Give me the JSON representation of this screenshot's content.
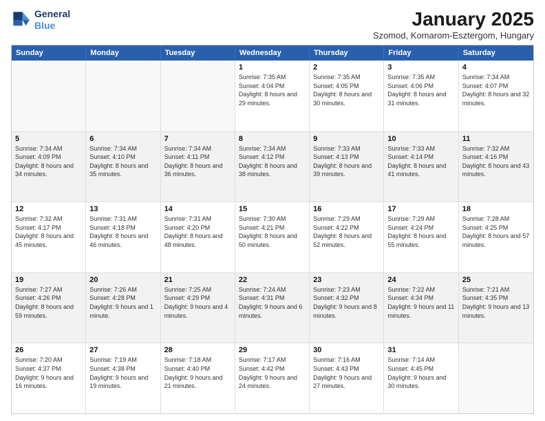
{
  "logo": {
    "line1": "General",
    "line2": "Blue"
  },
  "title": "January 2025",
  "subtitle": "Szomod, Komarom-Esztergom, Hungary",
  "days_header": [
    "Sunday",
    "Monday",
    "Tuesday",
    "Wednesday",
    "Thursday",
    "Friday",
    "Saturday"
  ],
  "weeks": [
    [
      {
        "num": "",
        "info": ""
      },
      {
        "num": "",
        "info": ""
      },
      {
        "num": "",
        "info": ""
      },
      {
        "num": "1",
        "info": "Sunrise: 7:35 AM\nSunset: 4:04 PM\nDaylight: 8 hours and 29 minutes."
      },
      {
        "num": "2",
        "info": "Sunrise: 7:35 AM\nSunset: 4:05 PM\nDaylight: 8 hours and 30 minutes."
      },
      {
        "num": "3",
        "info": "Sunrise: 7:35 AM\nSunset: 4:06 PM\nDaylight: 8 hours and 31 minutes."
      },
      {
        "num": "4",
        "info": "Sunrise: 7:34 AM\nSunset: 4:07 PM\nDaylight: 8 hours and 32 minutes."
      }
    ],
    [
      {
        "num": "5",
        "info": "Sunrise: 7:34 AM\nSunset: 4:09 PM\nDaylight: 8 hours and 34 minutes."
      },
      {
        "num": "6",
        "info": "Sunrise: 7:34 AM\nSunset: 4:10 PM\nDaylight: 8 hours and 35 minutes."
      },
      {
        "num": "7",
        "info": "Sunrise: 7:34 AM\nSunset: 4:11 PM\nDaylight: 8 hours and 36 minutes."
      },
      {
        "num": "8",
        "info": "Sunrise: 7:34 AM\nSunset: 4:12 PM\nDaylight: 8 hours and 38 minutes."
      },
      {
        "num": "9",
        "info": "Sunrise: 7:33 AM\nSunset: 4:13 PM\nDaylight: 8 hours and 39 minutes."
      },
      {
        "num": "10",
        "info": "Sunrise: 7:33 AM\nSunset: 4:14 PM\nDaylight: 8 hours and 41 minutes."
      },
      {
        "num": "11",
        "info": "Sunrise: 7:32 AM\nSunset: 4:16 PM\nDaylight: 8 hours and 43 minutes."
      }
    ],
    [
      {
        "num": "12",
        "info": "Sunrise: 7:32 AM\nSunset: 4:17 PM\nDaylight: 8 hours and 45 minutes."
      },
      {
        "num": "13",
        "info": "Sunrise: 7:31 AM\nSunset: 4:18 PM\nDaylight: 8 hours and 46 minutes."
      },
      {
        "num": "14",
        "info": "Sunrise: 7:31 AM\nSunset: 4:20 PM\nDaylight: 8 hours and 48 minutes."
      },
      {
        "num": "15",
        "info": "Sunrise: 7:30 AM\nSunset: 4:21 PM\nDaylight: 8 hours and 50 minutes."
      },
      {
        "num": "16",
        "info": "Sunrise: 7:29 AM\nSunset: 4:22 PM\nDaylight: 8 hours and 52 minutes."
      },
      {
        "num": "17",
        "info": "Sunrise: 7:29 AM\nSunset: 4:24 PM\nDaylight: 8 hours and 55 minutes."
      },
      {
        "num": "18",
        "info": "Sunrise: 7:28 AM\nSunset: 4:25 PM\nDaylight: 8 hours and 57 minutes."
      }
    ],
    [
      {
        "num": "19",
        "info": "Sunrise: 7:27 AM\nSunset: 4:26 PM\nDaylight: 8 hours and 59 minutes."
      },
      {
        "num": "20",
        "info": "Sunrise: 7:26 AM\nSunset: 4:28 PM\nDaylight: 9 hours and 1 minute."
      },
      {
        "num": "21",
        "info": "Sunrise: 7:25 AM\nSunset: 4:29 PM\nDaylight: 9 hours and 4 minutes."
      },
      {
        "num": "22",
        "info": "Sunrise: 7:24 AM\nSunset: 4:31 PM\nDaylight: 9 hours and 6 minutes."
      },
      {
        "num": "23",
        "info": "Sunrise: 7:23 AM\nSunset: 4:32 PM\nDaylight: 9 hours and 8 minutes."
      },
      {
        "num": "24",
        "info": "Sunrise: 7:22 AM\nSunset: 4:34 PM\nDaylight: 9 hours and 11 minutes."
      },
      {
        "num": "25",
        "info": "Sunrise: 7:21 AM\nSunset: 4:35 PM\nDaylight: 9 hours and 13 minutes."
      }
    ],
    [
      {
        "num": "26",
        "info": "Sunrise: 7:20 AM\nSunset: 4:37 PM\nDaylight: 9 hours and 16 minutes."
      },
      {
        "num": "27",
        "info": "Sunrise: 7:19 AM\nSunset: 4:38 PM\nDaylight: 9 hours and 19 minutes."
      },
      {
        "num": "28",
        "info": "Sunrise: 7:18 AM\nSunset: 4:40 PM\nDaylight: 9 hours and 21 minutes."
      },
      {
        "num": "29",
        "info": "Sunrise: 7:17 AM\nSunset: 4:42 PM\nDaylight: 9 hours and 24 minutes."
      },
      {
        "num": "30",
        "info": "Sunrise: 7:16 AM\nSunset: 4:43 PM\nDaylight: 9 hours and 27 minutes."
      },
      {
        "num": "31",
        "info": "Sunrise: 7:14 AM\nSunset: 4:45 PM\nDaylight: 9 hours and 30 minutes."
      },
      {
        "num": "",
        "info": ""
      }
    ]
  ]
}
